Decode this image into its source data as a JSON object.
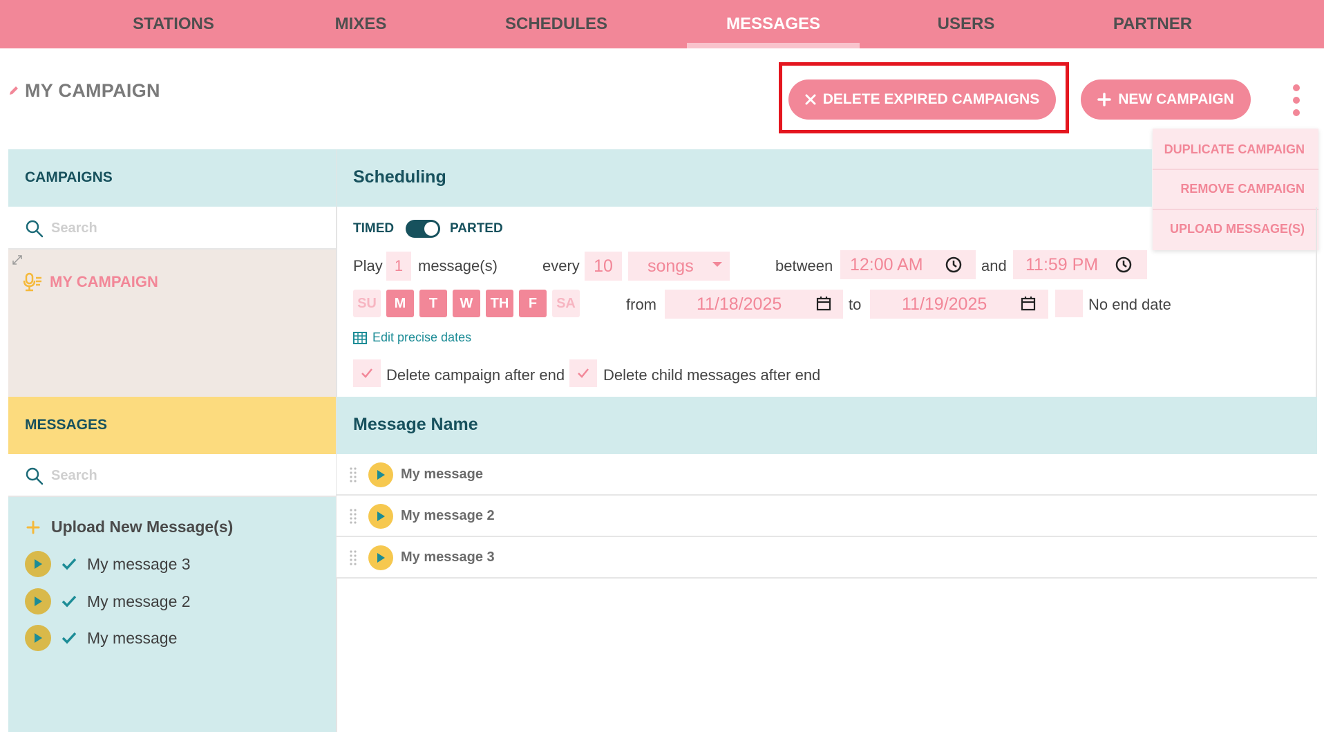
{
  "nav": {
    "tabs": [
      {
        "label": "STATIONS"
      },
      {
        "label": "MIXES"
      },
      {
        "label": "SCHEDULES"
      },
      {
        "label": "MESSAGES",
        "active": true
      },
      {
        "label": "USERS"
      },
      {
        "label": "PARTNER"
      }
    ]
  },
  "header": {
    "title": "MY CAMPAIGN",
    "delete_expired_label": "DELETE EXPIRED CAMPAIGNS",
    "new_campaign_label": "NEW CAMPAIGN"
  },
  "menu": {
    "items": [
      "DUPLICATE CAMPAIGN",
      "REMOVE CAMPAIGN",
      "UPLOAD MESSAGE(S)"
    ]
  },
  "campaigns": {
    "heading": "CAMPAIGNS",
    "search_placeholder": "Search",
    "items": [
      {
        "label": "MY CAMPAIGN"
      }
    ]
  },
  "messages_panel": {
    "heading": "MESSAGES",
    "search_placeholder": "Search",
    "upload_label": "Upload New Message(s)",
    "items": [
      "My message 3",
      "My message 2",
      "My message"
    ]
  },
  "scheduling": {
    "title": "Scheduling",
    "toggle_left": "TIMED",
    "toggle_right": "PARTED",
    "toggle_on": true,
    "play_label": "Play",
    "play_count": "1",
    "messages_label": "message(s)",
    "every_label": "every",
    "every_count": "10",
    "unit": "songs",
    "between_label": "between",
    "start_time": "12:00 AM",
    "and_label": "and",
    "end_time": "11:59 PM",
    "days": [
      {
        "label": "SU",
        "on": false
      },
      {
        "label": "M",
        "on": true
      },
      {
        "label": "T",
        "on": true
      },
      {
        "label": "W",
        "on": true
      },
      {
        "label": "TH",
        "on": true
      },
      {
        "label": "F",
        "on": true
      },
      {
        "label": "SA",
        "on": false
      }
    ],
    "from_label": "from",
    "start_date": "11/18/2025",
    "to_label": "to",
    "end_date": "11/19/2025",
    "no_end_label": "No end date",
    "edit_dates_label": "Edit precise dates",
    "delete_after_end_label": "Delete campaign after end",
    "delete_children_label": "Delete child messages after end"
  },
  "message_table": {
    "heading": "Message Name",
    "rows": [
      "My message",
      "My message 2",
      "My message 3"
    ]
  },
  "colors": {
    "brand_pink": "#f28798",
    "light_pink": "#fde7eb",
    "teal_panel": "#d2ebec",
    "yellow_panel": "#fcdb7e",
    "dark_teal": "#17515d",
    "highlight_red": "#e4161f"
  }
}
